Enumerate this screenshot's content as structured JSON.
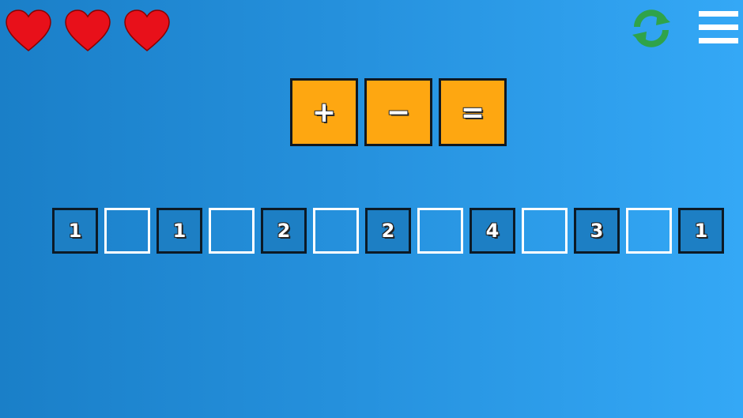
{
  "hud": {
    "lives": 3,
    "heart_color": "#e8101a",
    "refresh_color": "#2fa34a",
    "menu_color": "#ffffff"
  },
  "operators": [
    {
      "symbol": "+"
    },
    {
      "symbol": "−"
    },
    {
      "symbol": "="
    }
  ],
  "equation": {
    "numbers": [
      "1",
      "1",
      "2",
      "2",
      "4",
      "3",
      "1"
    ],
    "slots_empty": 6
  },
  "colors": {
    "operator_tile": "#fea711",
    "number_tile": "#1d7fc4",
    "slot_border": "#ffffff"
  }
}
